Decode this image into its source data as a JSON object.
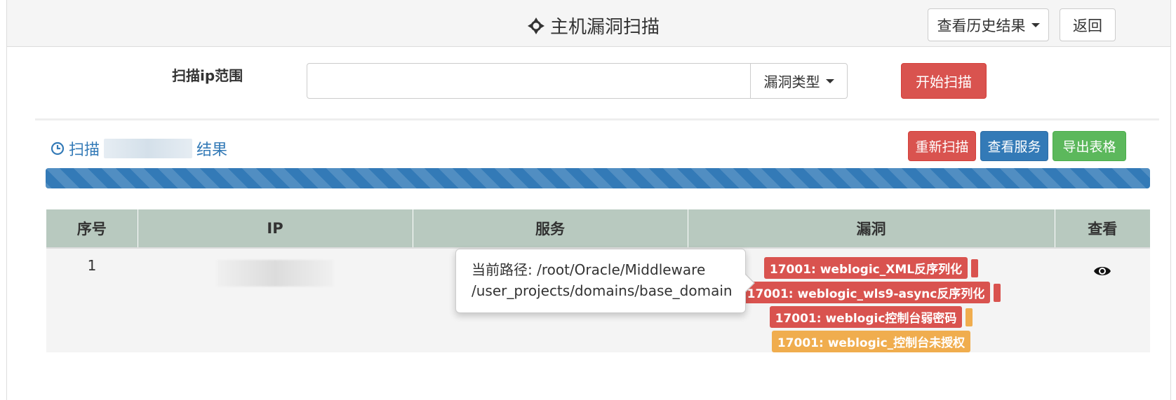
{
  "header": {
    "title": "主机漏洞扫描",
    "history_button": "查看历史结果",
    "back_button": "返回"
  },
  "scan_form": {
    "range_label": "扫描ip范围",
    "ip_input_value": "",
    "vuln_type_button": "漏洞类型",
    "start_button": "开始扫描"
  },
  "result": {
    "heading_prefix": "扫描",
    "heading_suffix": "结果",
    "actions": {
      "rescan": "重新扫描",
      "view_services": "查看服务",
      "export": "导出表格"
    },
    "progress_percent": 100
  },
  "table": {
    "headers": [
      "序号",
      "IP",
      "服务",
      "漏洞",
      "查看"
    ],
    "rows": [
      {
        "index": "1",
        "vulns": [
          {
            "text": "17001: weblogic_XML反序列化",
            "level": "danger"
          },
          {
            "text": "17001: weblogic_wls9-async反序列化",
            "level": "danger"
          },
          {
            "text": "17001: weblogic控制台弱密码",
            "level": "danger"
          },
          {
            "text": "17001: weblogic_控制台未授权",
            "level": "warning"
          }
        ]
      }
    ]
  },
  "tooltip": {
    "line1": "当前路径: /root/Oracle/Middleware",
    "line2": "/user_projects/domains/base_domain"
  },
  "colors": {
    "danger": "#d9534f",
    "warning": "#f0ad4e",
    "primary": "#337ab7",
    "success": "#5cb85c",
    "table_header": "#b8c9bf"
  },
  "icons": {
    "title": "crosshair-icon",
    "result": "clock-icon",
    "view": "eye-icon"
  }
}
